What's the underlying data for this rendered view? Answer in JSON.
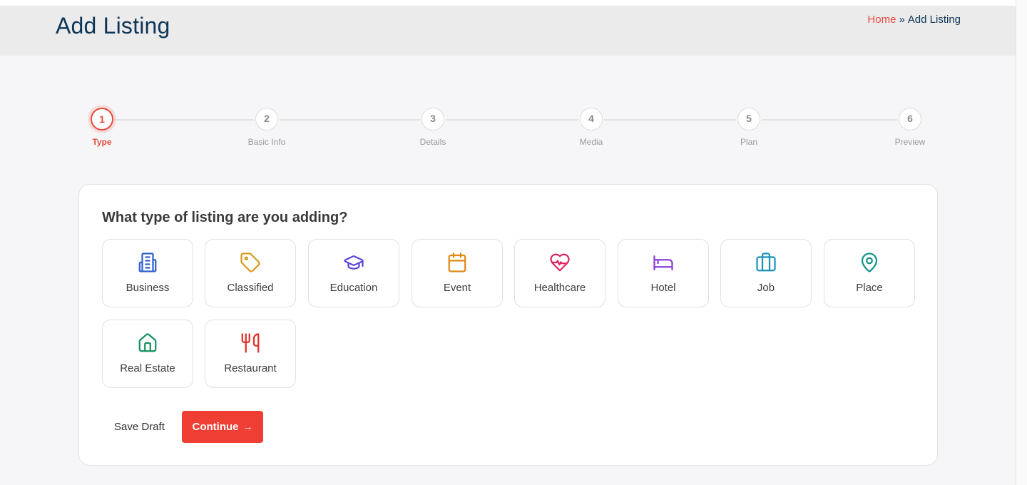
{
  "header": {
    "title": "Add Listing",
    "breadcrumb": {
      "home": "Home",
      "separator": "»",
      "current": "Add Listing"
    }
  },
  "stepper": {
    "active_step": 1,
    "steps": [
      {
        "number": "1",
        "label": "Type"
      },
      {
        "number": "2",
        "label": "Basic Info"
      },
      {
        "number": "3",
        "label": "Details"
      },
      {
        "number": "4",
        "label": "Media"
      },
      {
        "number": "5",
        "label": "Plan"
      },
      {
        "number": "6",
        "label": "Preview"
      }
    ]
  },
  "form": {
    "question": "What type of listing are you adding?",
    "types": [
      {
        "label": "Business",
        "icon": "building-icon",
        "color": "#2f5fd0"
      },
      {
        "label": "Classified",
        "icon": "tag-icon",
        "color": "#d69a1b"
      },
      {
        "label": "Education",
        "icon": "graduation-cap-icon",
        "color": "#5a46d6"
      },
      {
        "label": "Event",
        "icon": "calendar-icon",
        "color": "#de8a14"
      },
      {
        "label": "Healthcare",
        "icon": "heart-pulse-icon",
        "color": "#e0245e"
      },
      {
        "label": "Hotel",
        "icon": "bed-icon",
        "color": "#8a3fd8"
      },
      {
        "label": "Job",
        "icon": "briefcase-icon",
        "color": "#1a93b8"
      },
      {
        "label": "Place",
        "icon": "map-pin-icon",
        "color": "#14958a"
      },
      {
        "label": "Real Estate",
        "icon": "house-icon",
        "color": "#16925e"
      },
      {
        "label": "Restaurant",
        "icon": "utensils-icon",
        "color": "#e0302a"
      }
    ],
    "save_draft_label": "Save Draft",
    "continue_label": "Continue",
    "continue_arrow": "→"
  },
  "colors": {
    "accent": "#ef3e33",
    "title": "#0e3656",
    "header_bg": "#ebebec",
    "page_bg": "#f6f6f8"
  }
}
